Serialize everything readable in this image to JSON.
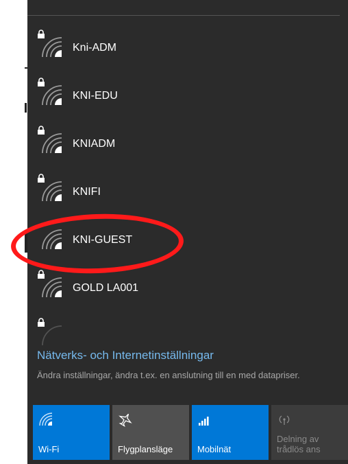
{
  "networks": [
    {
      "name": "Kni-ADM",
      "secured": true
    },
    {
      "name": "KNI-EDU",
      "secured": true
    },
    {
      "name": "KNIADM",
      "secured": true
    },
    {
      "name": "KNIFI",
      "secured": true
    },
    {
      "name": "KNI-GUEST",
      "secured": false
    },
    {
      "name": "GOLD LA001",
      "secured": true
    }
  ],
  "settings": {
    "link": "Nätverks- och Internetinställningar",
    "description": "Ändra inställningar, ändra t.ex. en anslutning till en med datapriser."
  },
  "quick_actions": [
    {
      "label": "Wi-Fi",
      "icon": "wifi-icon",
      "state": "on"
    },
    {
      "label": "Flygplansläge",
      "icon": "airplane-icon",
      "state": "off"
    },
    {
      "label": "Mobilnät",
      "icon": "cellular-icon",
      "state": "on"
    },
    {
      "label": "Delning av trådlös ans",
      "icon": "hotspot-icon",
      "state": "disabled"
    }
  ],
  "colors": {
    "accent": "#0078d7",
    "link": "#76b9ed",
    "highlight": "#ff1a1a",
    "flyout_bg": "#2b2b2b"
  }
}
